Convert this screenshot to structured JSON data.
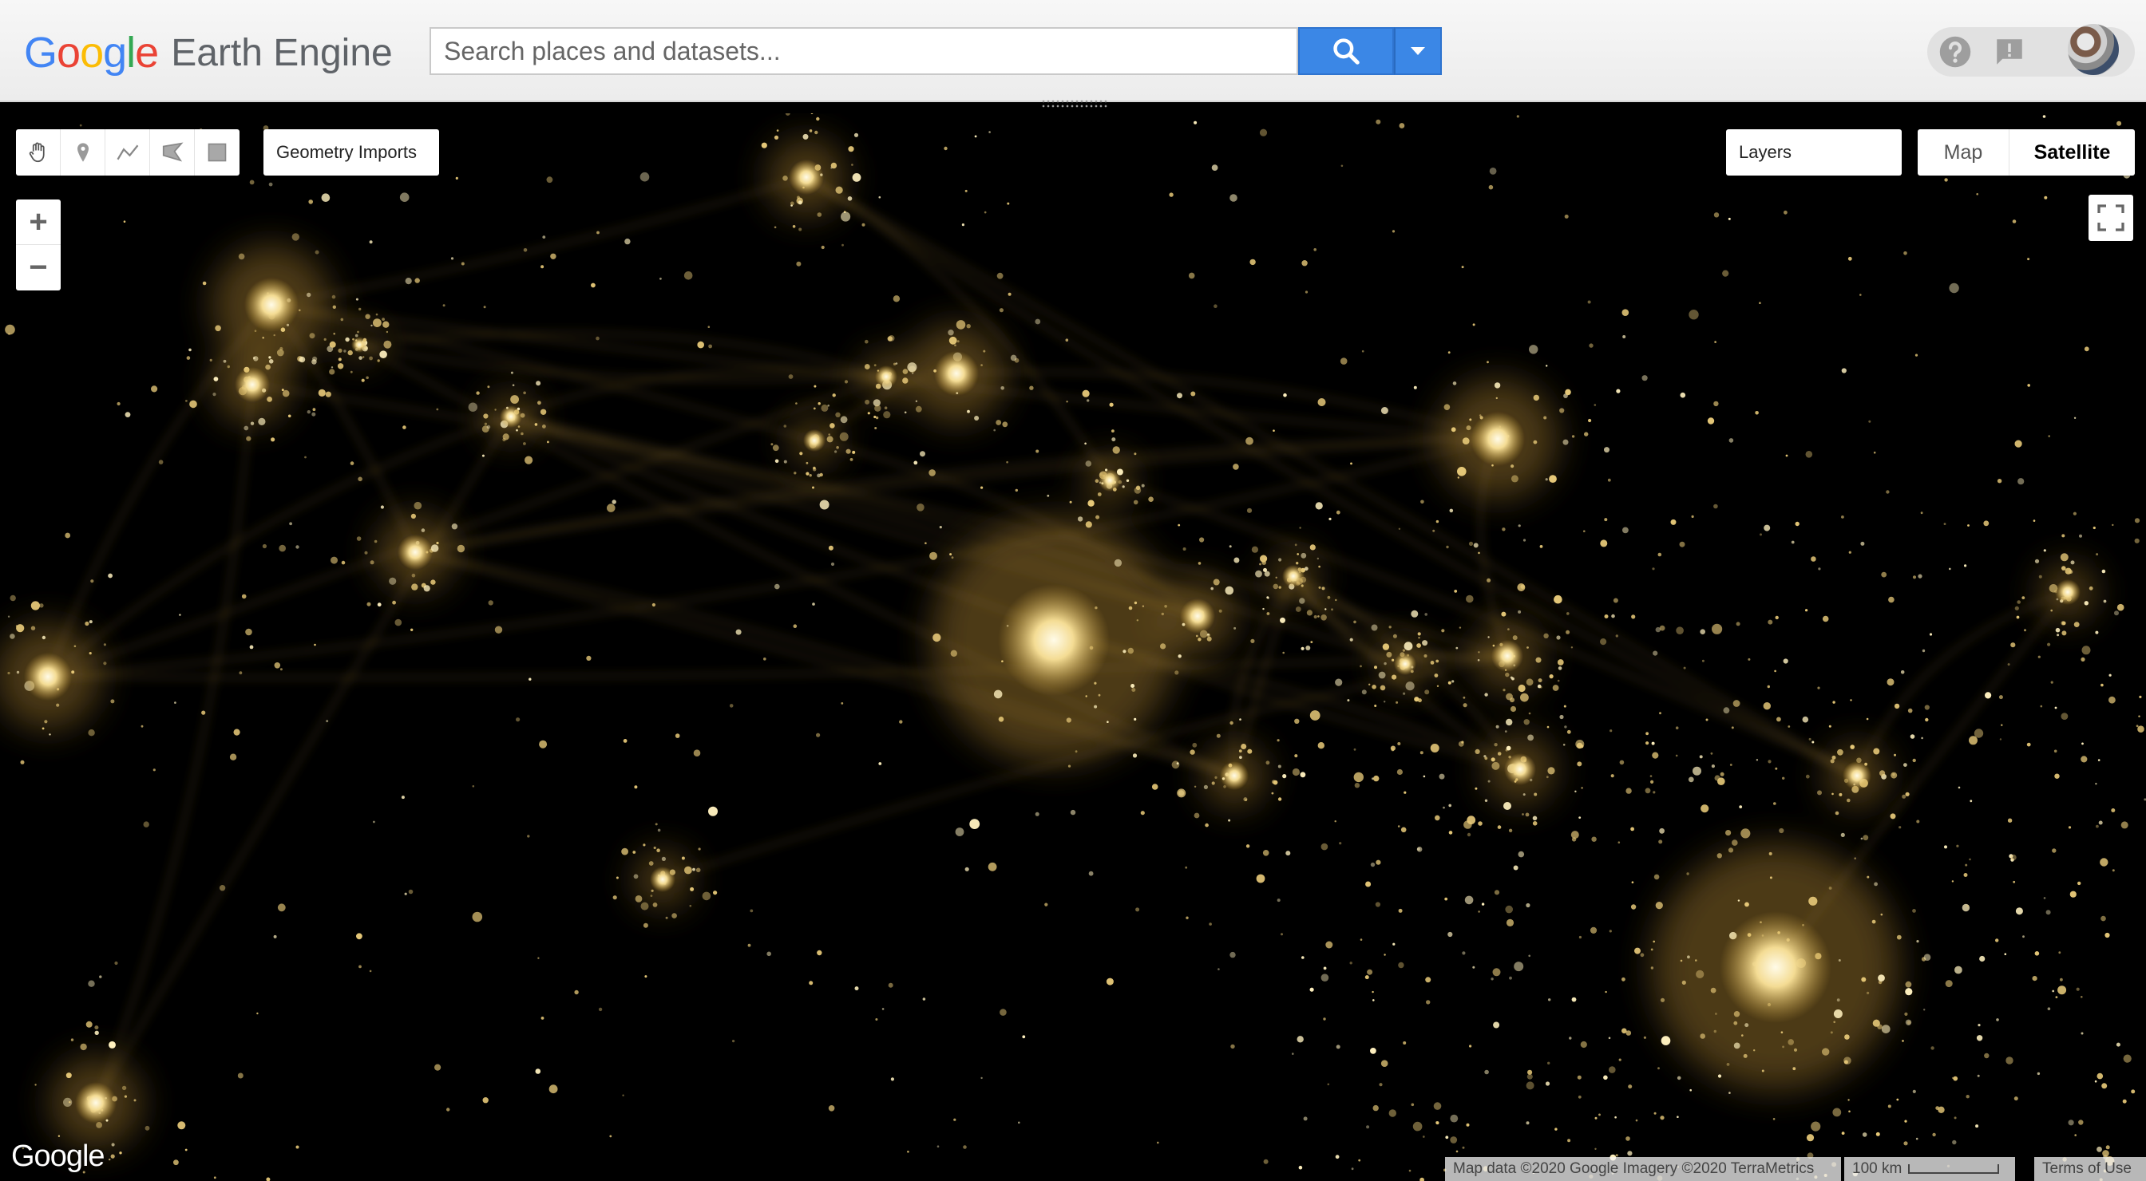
{
  "header": {
    "logo_letters": [
      "G",
      "o",
      "o",
      "g",
      "l",
      "e"
    ],
    "product": "Earth Engine",
    "search_placeholder": "Search places and datasets...",
    "icons": {
      "search": "search-icon",
      "dropdown": "caret-down-icon",
      "help": "help-icon",
      "feedback": "feedback-icon"
    }
  },
  "map": {
    "toolbar_tools": [
      "hand-tool-icon",
      "marker-tool-icon",
      "line-tool-icon",
      "polygon-tool-icon",
      "rectangle-tool-icon"
    ],
    "geometry_imports": "Geometry Imports",
    "zoom_in": "+",
    "zoom_out": "−",
    "layers": "Layers",
    "maptype_map": "Map",
    "maptype_satellite": "Satellite",
    "google_logo": "Google",
    "attribution": "Map data ©2020 Google Imagery ©2020 TerraMetrics",
    "scale_label": "100 km",
    "terms": "Terms of Use",
    "colors": {
      "light": "#fff4c9",
      "glow": "#d8b25a",
      "background": "#000000"
    }
  }
}
